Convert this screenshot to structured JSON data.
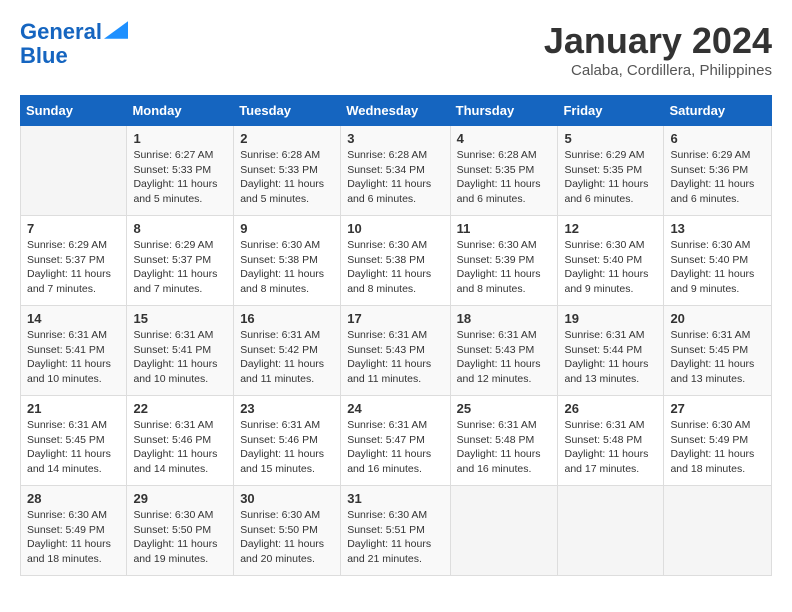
{
  "header": {
    "logo_line1": "General",
    "logo_line2": "Blue",
    "month": "January 2024",
    "location": "Calaba, Cordillera, Philippines"
  },
  "days_of_week": [
    "Sunday",
    "Monday",
    "Tuesday",
    "Wednesday",
    "Thursday",
    "Friday",
    "Saturday"
  ],
  "weeks": [
    [
      {
        "day": "",
        "info": ""
      },
      {
        "day": "1",
        "info": "Sunrise: 6:27 AM\nSunset: 5:33 PM\nDaylight: 11 hours\nand 5 minutes."
      },
      {
        "day": "2",
        "info": "Sunrise: 6:28 AM\nSunset: 5:33 PM\nDaylight: 11 hours\nand 5 minutes."
      },
      {
        "day": "3",
        "info": "Sunrise: 6:28 AM\nSunset: 5:34 PM\nDaylight: 11 hours\nand 6 minutes."
      },
      {
        "day": "4",
        "info": "Sunrise: 6:28 AM\nSunset: 5:35 PM\nDaylight: 11 hours\nand 6 minutes."
      },
      {
        "day": "5",
        "info": "Sunrise: 6:29 AM\nSunset: 5:35 PM\nDaylight: 11 hours\nand 6 minutes."
      },
      {
        "day": "6",
        "info": "Sunrise: 6:29 AM\nSunset: 5:36 PM\nDaylight: 11 hours\nand 6 minutes."
      }
    ],
    [
      {
        "day": "7",
        "info": "Sunrise: 6:29 AM\nSunset: 5:37 PM\nDaylight: 11 hours\nand 7 minutes."
      },
      {
        "day": "8",
        "info": "Sunrise: 6:29 AM\nSunset: 5:37 PM\nDaylight: 11 hours\nand 7 minutes."
      },
      {
        "day": "9",
        "info": "Sunrise: 6:30 AM\nSunset: 5:38 PM\nDaylight: 11 hours\nand 8 minutes."
      },
      {
        "day": "10",
        "info": "Sunrise: 6:30 AM\nSunset: 5:38 PM\nDaylight: 11 hours\nand 8 minutes."
      },
      {
        "day": "11",
        "info": "Sunrise: 6:30 AM\nSunset: 5:39 PM\nDaylight: 11 hours\nand 8 minutes."
      },
      {
        "day": "12",
        "info": "Sunrise: 6:30 AM\nSunset: 5:40 PM\nDaylight: 11 hours\nand 9 minutes."
      },
      {
        "day": "13",
        "info": "Sunrise: 6:30 AM\nSunset: 5:40 PM\nDaylight: 11 hours\nand 9 minutes."
      }
    ],
    [
      {
        "day": "14",
        "info": "Sunrise: 6:31 AM\nSunset: 5:41 PM\nDaylight: 11 hours\nand 10 minutes."
      },
      {
        "day": "15",
        "info": "Sunrise: 6:31 AM\nSunset: 5:41 PM\nDaylight: 11 hours\nand 10 minutes."
      },
      {
        "day": "16",
        "info": "Sunrise: 6:31 AM\nSunset: 5:42 PM\nDaylight: 11 hours\nand 11 minutes."
      },
      {
        "day": "17",
        "info": "Sunrise: 6:31 AM\nSunset: 5:43 PM\nDaylight: 11 hours\nand 11 minutes."
      },
      {
        "day": "18",
        "info": "Sunrise: 6:31 AM\nSunset: 5:43 PM\nDaylight: 11 hours\nand 12 minutes."
      },
      {
        "day": "19",
        "info": "Sunrise: 6:31 AM\nSunset: 5:44 PM\nDaylight: 11 hours\nand 13 minutes."
      },
      {
        "day": "20",
        "info": "Sunrise: 6:31 AM\nSunset: 5:45 PM\nDaylight: 11 hours\nand 13 minutes."
      }
    ],
    [
      {
        "day": "21",
        "info": "Sunrise: 6:31 AM\nSunset: 5:45 PM\nDaylight: 11 hours\nand 14 minutes."
      },
      {
        "day": "22",
        "info": "Sunrise: 6:31 AM\nSunset: 5:46 PM\nDaylight: 11 hours\nand 14 minutes."
      },
      {
        "day": "23",
        "info": "Sunrise: 6:31 AM\nSunset: 5:46 PM\nDaylight: 11 hours\nand 15 minutes."
      },
      {
        "day": "24",
        "info": "Sunrise: 6:31 AM\nSunset: 5:47 PM\nDaylight: 11 hours\nand 16 minutes."
      },
      {
        "day": "25",
        "info": "Sunrise: 6:31 AM\nSunset: 5:48 PM\nDaylight: 11 hours\nand 16 minutes."
      },
      {
        "day": "26",
        "info": "Sunrise: 6:31 AM\nSunset: 5:48 PM\nDaylight: 11 hours\nand 17 minutes."
      },
      {
        "day": "27",
        "info": "Sunrise: 6:30 AM\nSunset: 5:49 PM\nDaylight: 11 hours\nand 18 minutes."
      }
    ],
    [
      {
        "day": "28",
        "info": "Sunrise: 6:30 AM\nSunset: 5:49 PM\nDaylight: 11 hours\nand 18 minutes."
      },
      {
        "day": "29",
        "info": "Sunrise: 6:30 AM\nSunset: 5:50 PM\nDaylight: 11 hours\nand 19 minutes."
      },
      {
        "day": "30",
        "info": "Sunrise: 6:30 AM\nSunset: 5:50 PM\nDaylight: 11 hours\nand 20 minutes."
      },
      {
        "day": "31",
        "info": "Sunrise: 6:30 AM\nSunset: 5:51 PM\nDaylight: 11 hours\nand 21 minutes."
      },
      {
        "day": "",
        "info": ""
      },
      {
        "day": "",
        "info": ""
      },
      {
        "day": "",
        "info": ""
      }
    ]
  ]
}
